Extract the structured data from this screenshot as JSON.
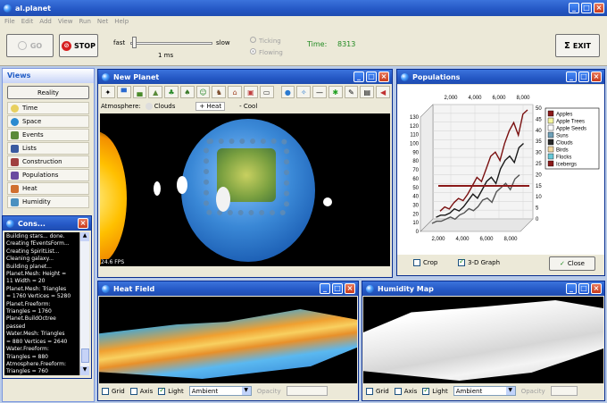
{
  "app": {
    "title": "al.planet"
  },
  "menu": [
    "File",
    "Edit",
    "Add",
    "View",
    "Run",
    "Net",
    "Help"
  ],
  "toolbar": {
    "go": "GO",
    "stop": "STOP",
    "fast": "fast",
    "slow": "slow",
    "speed": "1 ms",
    "ticking": "Ticking",
    "flowing": "Flowing",
    "time_label": "Time:",
    "time_value": "8313",
    "exit": "EXIT"
  },
  "views": {
    "title": "Views",
    "reality": "Reality",
    "items": [
      "Time",
      "Space",
      "Events",
      "Lists",
      "Construction",
      "Populations",
      "Heat",
      "Humidity"
    ]
  },
  "console": {
    "title": "Cons...",
    "lines": [
      "Building stars... done.",
      "Creating fEventsForm...",
      "Creating SpiritList...",
      "Cleaning galaxy...",
      "Building planet...",
      "Planet.Mesh: Height =",
      "11 Width = 20",
      "Planet.Mesh: Triangles",
      "= 1760 Vertices = 5280",
      "Planet.Freeform:",
      "Triangles = 1760",
      "Planet.BuildOctree",
      "passed",
      "Water.Mesh: Triangles",
      "= 880 Vertices = 2640",
      "Water.Freeform:",
      "Triangles = 880",
      "Atmosphere.Freeform:",
      "Triangles = 760"
    ]
  },
  "planet": {
    "title": "New Planet",
    "atmosphere_label": "Atmosphere:",
    "clouds": "Clouds",
    "heat": "Heat",
    "cool": "Cool",
    "fps": "24.6 FPS"
  },
  "populations": {
    "title": "Populations",
    "crop": "Crop",
    "graph3d": "3-D Graph",
    "close": "Close"
  },
  "chart_data": {
    "type": "line",
    "title": "",
    "x_ticks_top": [
      "2,000",
      "4,000",
      "6,000",
      "8,000"
    ],
    "x_ticks_bottom": [
      "2,000",
      "4,000",
      "6,000",
      "8,000"
    ],
    "y_ticks_left": [
      "130",
      "120",
      "110",
      "100",
      "90",
      "80",
      "70",
      "60",
      "50",
      "40",
      "30",
      "20",
      "10",
      "0"
    ],
    "y_ticks_right": [
      "50",
      "45",
      "40",
      "35",
      "30",
      "25",
      "20",
      "15",
      "10",
      "5",
      "0"
    ],
    "legend": [
      "Apples",
      "Apple Trees",
      "Apple Seeds",
      "Suns",
      "Clouds",
      "Birds",
      "Flocks",
      "Icebergs"
    ],
    "legend_colors": [
      "#8b1a1a",
      "#f5f5a0",
      "#ffffff",
      "#6fa0b8",
      "#2a2a2a",
      "#f2d8a0",
      "#67c8d8",
      "#8b1a1a"
    ],
    "series": [
      {
        "name": "Apples",
        "color": "#7a1010",
        "values": [
          2,
          4,
          3,
          6,
          8,
          7,
          10,
          14,
          18,
          16,
          22,
          28,
          30,
          26,
          34,
          40,
          44,
          38,
          48,
          50
        ]
      },
      {
        "name": "Clouds",
        "color": "#1a1a1a",
        "values": [
          1,
          2,
          2,
          3,
          5,
          4,
          6,
          9,
          12,
          10,
          14,
          18,
          20,
          17,
          24,
          28,
          30,
          27,
          34,
          36
        ]
      },
      {
        "name": "Apple Seeds",
        "color": "#555555",
        "values": [
          0,
          1,
          1,
          2,
          3,
          2,
          4,
          5,
          7,
          6,
          8,
          11,
          12,
          10,
          15,
          17,
          19,
          16,
          21,
          23
        ]
      }
    ],
    "ylim": [
      0,
      50
    ]
  },
  "heat": {
    "title": "Heat Field",
    "grid": "Grid",
    "axis": "Axis",
    "light": "Light",
    "mode": "Ambient",
    "opacity": "Opacity"
  },
  "humidity": {
    "title": "Humidity Map",
    "grid": "Grid",
    "axis": "Axis",
    "light": "Light",
    "mode": "Ambient",
    "opacity": "Opacity"
  },
  "colors": {
    "accent": "#2457c4",
    "time": "#218a21"
  }
}
